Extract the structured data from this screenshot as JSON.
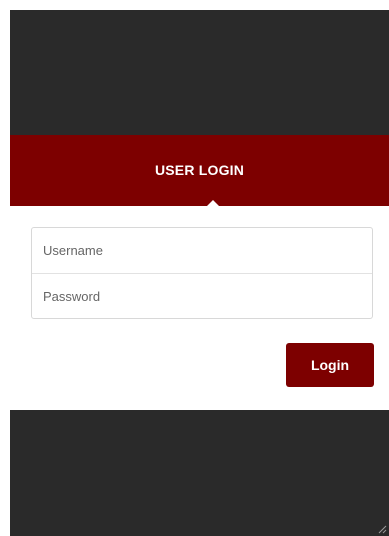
{
  "header": {
    "title": "USER LOGIN"
  },
  "form": {
    "username_placeholder": "Username",
    "username_value": "",
    "password_placeholder": "Password",
    "password_value": "",
    "login_label": "Login"
  },
  "colors": {
    "brand": "#7d0000",
    "background_dark": "#2a2a2a",
    "panel": "#ffffff"
  }
}
